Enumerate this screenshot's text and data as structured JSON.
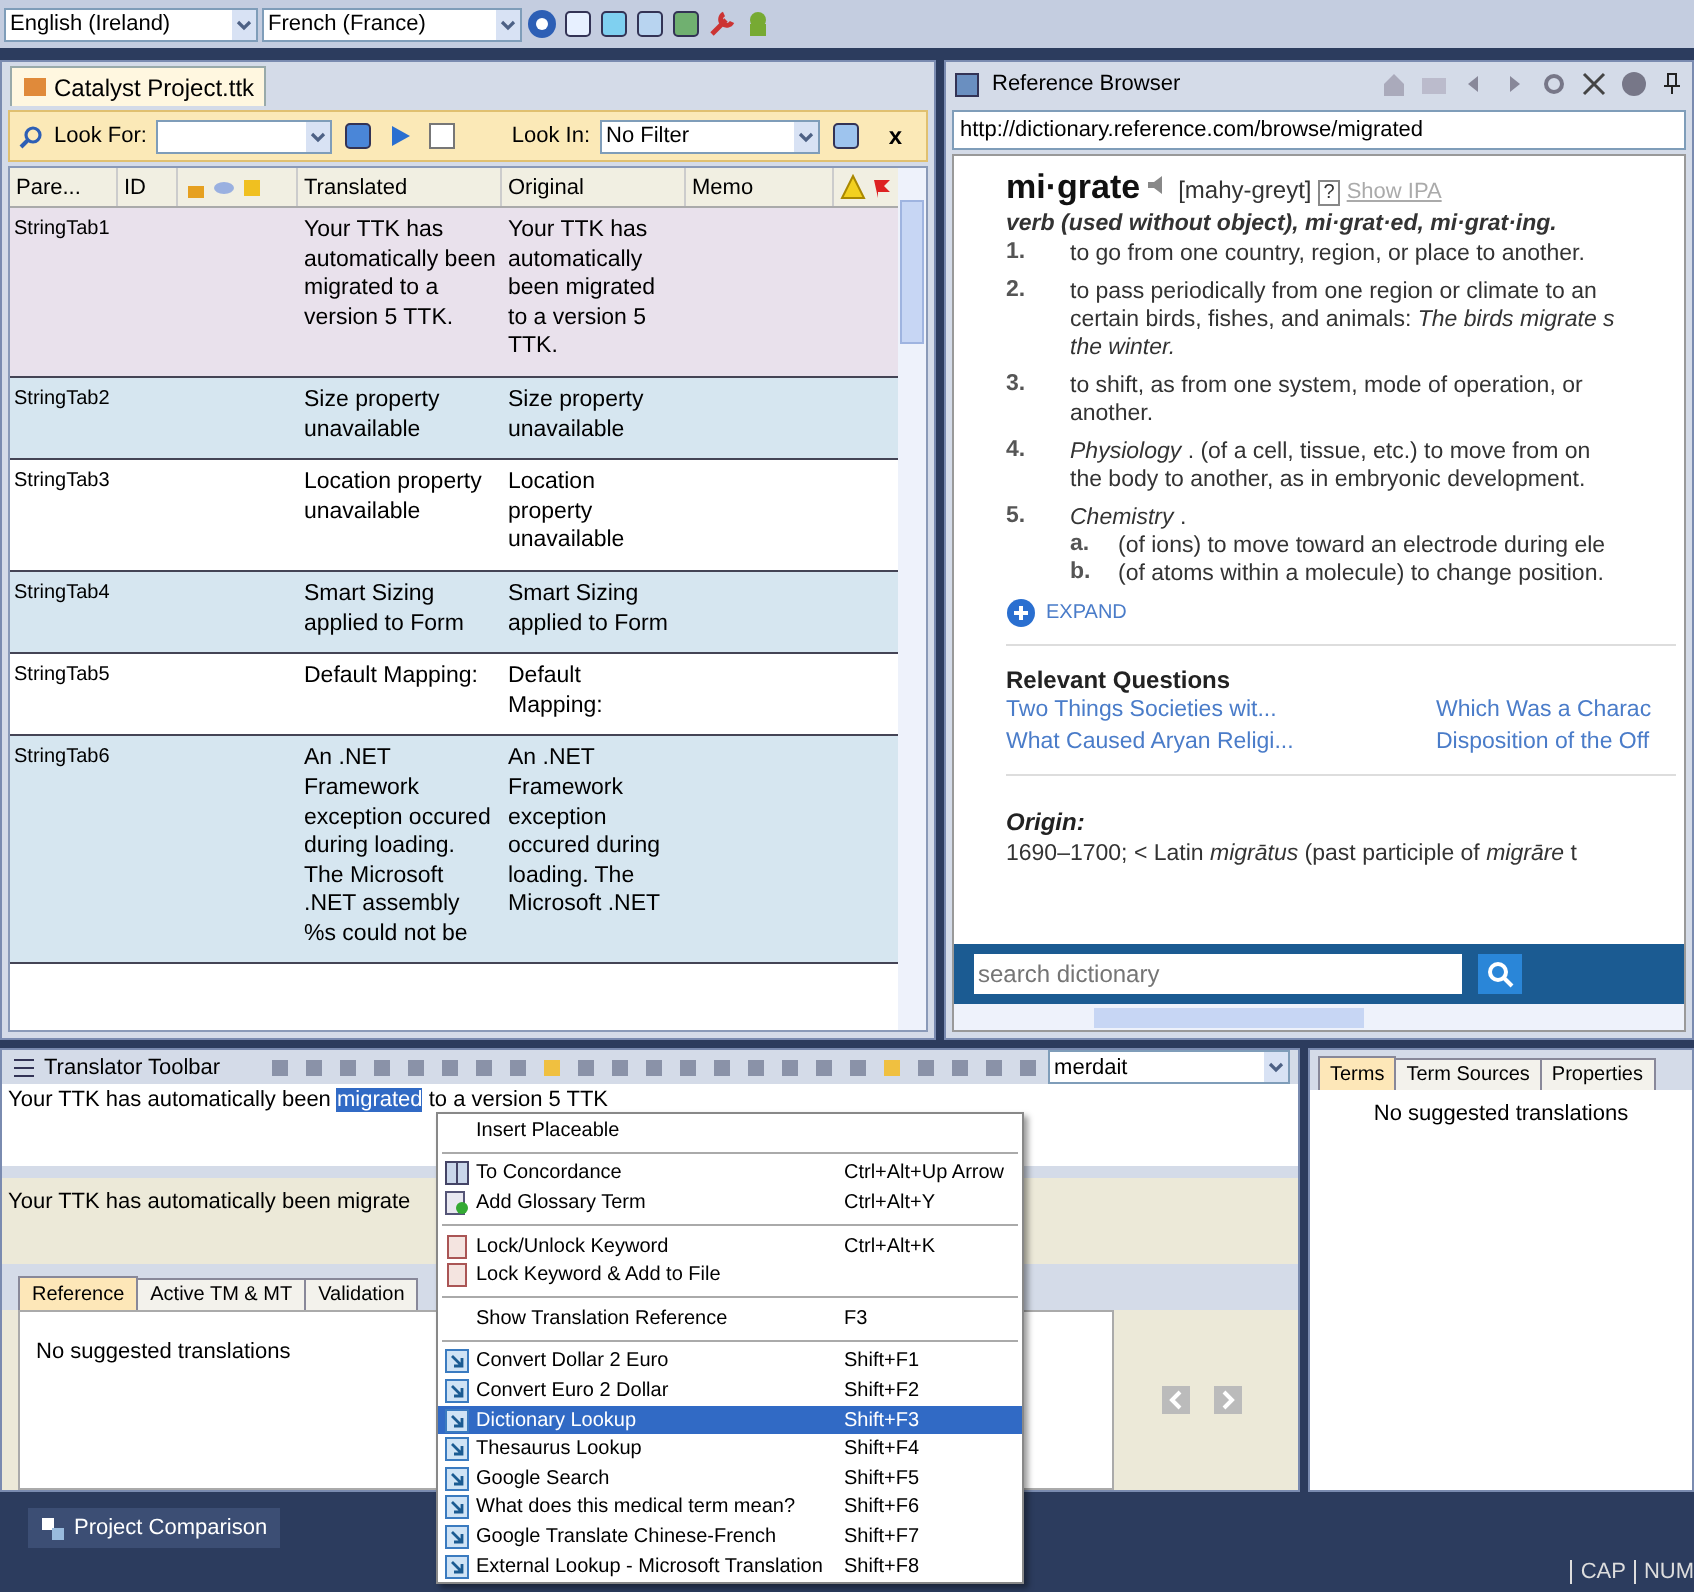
{
  "language_bar": {
    "source": "English (Ireland)",
    "target": "French (France)"
  },
  "document": {
    "tab": "Catalyst Project.ttk",
    "look_for_label": "Look For:",
    "look_in_label": "Look In:",
    "look_in_value": "No Filter",
    "close": "x",
    "columns": [
      "Pare...",
      "ID",
      "Translated",
      "Original",
      "Memo"
    ],
    "rows": [
      {
        "parent": "StringTab1",
        "translated": "Your TTK has automatically been migrated to a version 5 TTK.",
        "original": "Your TTK has automatically been migrated to a version 5 TTK.",
        "selected": true
      },
      {
        "parent": "StringTab2",
        "translated": "Size property unavailable",
        "original": "Size property unavailable",
        "selected": false
      },
      {
        "parent": "StringTab3",
        "translated": "Location property unavailable",
        "original": "Location property unavailable",
        "selected": false
      },
      {
        "parent": "StringTab4",
        "translated": "Smart Sizing applied to Form",
        "original": "Smart Sizing applied to Form",
        "selected": false
      },
      {
        "parent": "StringTab5",
        "translated": "Default Mapping:",
        "original": "Default Mapping:",
        "selected": false
      },
      {
        "parent": "StringTab6",
        "translated": "An .NET Framework exception occured during loading. The Microsoft .NET assembly %s could not be",
        "original": "An .NET Framework exception occured during loading. The Microsoft .NET",
        "selected": false
      }
    ]
  },
  "browser": {
    "title": "Reference Browser",
    "url": "http://dictionary.reference.com/browse/migrated",
    "headword": "mi·grate",
    "pronunciation": "[mahy-greyt]",
    "help": "?",
    "show_ipa": "Show IPA",
    "pos": "verb (used without object),  mi·grat·ed, mi·grat·ing.",
    "definitions": [
      {
        "num": "1.",
        "lines": [
          "to go from one country, region, or place to another."
        ]
      },
      {
        "num": "2.",
        "lines": [
          "to pass periodically from one region or climate to an",
          "certain birds, fishes, and animals: *The birds migrate s*",
          "*the winter.*"
        ]
      },
      {
        "num": "3.",
        "lines": [
          "to shift, as from one system, mode of operation, or",
          "another."
        ]
      },
      {
        "num": "4.",
        "lines": [
          "*Physiology* . (of a cell, tissue, etc.) to move from on",
          "the body to another, as in embryonic development."
        ]
      },
      {
        "num": "5.",
        "lines": [
          "*Chemistry* ."
        ],
        "subs": [
          {
            "num": "a.",
            "text": "(of ions) to move toward an electrode during ele"
          },
          {
            "num": "b.",
            "text": "(of atoms within a molecule) to change position."
          }
        ]
      }
    ],
    "expand": "EXPAND",
    "questions_title": "Relevant Questions",
    "questions": [
      "Two Things Societies wit...",
      "Which Was a Charac",
      "What Caused Aryan Religi...",
      "Disposition of the Off"
    ],
    "origin_title": "Origin:",
    "origin": "1690–1700;  < Latin *migrātus* (past participle of *migrāre* t",
    "search_placeholder": "search dictionary"
  },
  "translator_toolbar": {
    "title": "Translator Toolbar",
    "term_value": "merdait"
  },
  "editor": {
    "target_before": "Your TTK has automatically been ",
    "target_selected": "migrated",
    "target_after": " to a version 5 TTK",
    "source": "Your TTK has automatically been migrate"
  },
  "bottom_tabs": [
    {
      "label": "Reference",
      "selected": true
    },
    {
      "label": "Active TM & MT",
      "selected": false
    },
    {
      "label": "Validation",
      "selected": false
    }
  ],
  "reference_message": "No suggested translations",
  "side_tabs": [
    {
      "label": "Terms",
      "selected": true
    },
    {
      "label": "Term Sources",
      "selected": false
    },
    {
      "label": "Properties",
      "selected": false
    }
  ],
  "terms_message": "No suggested translations",
  "taskbar": {
    "item": "Project Comparison",
    "indicators": [
      "CAP",
      "NUM"
    ]
  },
  "context_menu": [
    {
      "kind": "item",
      "label": "Insert Placeable",
      "selected": false
    },
    {
      "kind": "separator"
    },
    {
      "kind": "item",
      "label": "To Concordance",
      "shortcut": "Ctrl+Alt+Up Arrow",
      "selected": false
    },
    {
      "kind": "item",
      "label": "Add Glossary Term",
      "shortcut": "Ctrl+Alt+Y",
      "selected": false
    },
    {
      "kind": "separator"
    },
    {
      "kind": "item",
      "label": "Lock/Unlock Keyword",
      "shortcut": "Ctrl+Alt+K",
      "selected": false
    },
    {
      "kind": "item",
      "label": "Lock Keyword & Add to File",
      "selected": false
    },
    {
      "kind": "separator"
    },
    {
      "kind": "item",
      "label": "Show Translation Reference",
      "shortcut": "F3",
      "selected": false
    },
    {
      "kind": "separator"
    },
    {
      "kind": "item",
      "label": "Convert Dollar 2 Euro",
      "shortcut": "Shift+F1",
      "selected": false
    },
    {
      "kind": "item",
      "label": "Convert Euro 2 Dollar",
      "shortcut": "Shift+F2",
      "selected": false
    },
    {
      "kind": "item",
      "label": "Dictionary Lookup",
      "shortcut": "Shift+F3",
      "selected": true
    },
    {
      "kind": "item",
      "label": "Thesaurus Lookup",
      "shortcut": "Shift+F4",
      "selected": false
    },
    {
      "kind": "item",
      "label": "Google Search",
      "shortcut": "Shift+F5",
      "selected": false
    },
    {
      "kind": "item",
      "label": "What does this medical term mean?",
      "shortcut": "Shift+F6",
      "selected": false
    },
    {
      "kind": "item",
      "label": "Google Translate Chinese-French",
      "shortcut": "Shift+F7",
      "selected": false
    },
    {
      "kind": "item",
      "label": "External Lookup - Microsoft Translation",
      "shortcut": "Shift+F8",
      "selected": false
    }
  ]
}
